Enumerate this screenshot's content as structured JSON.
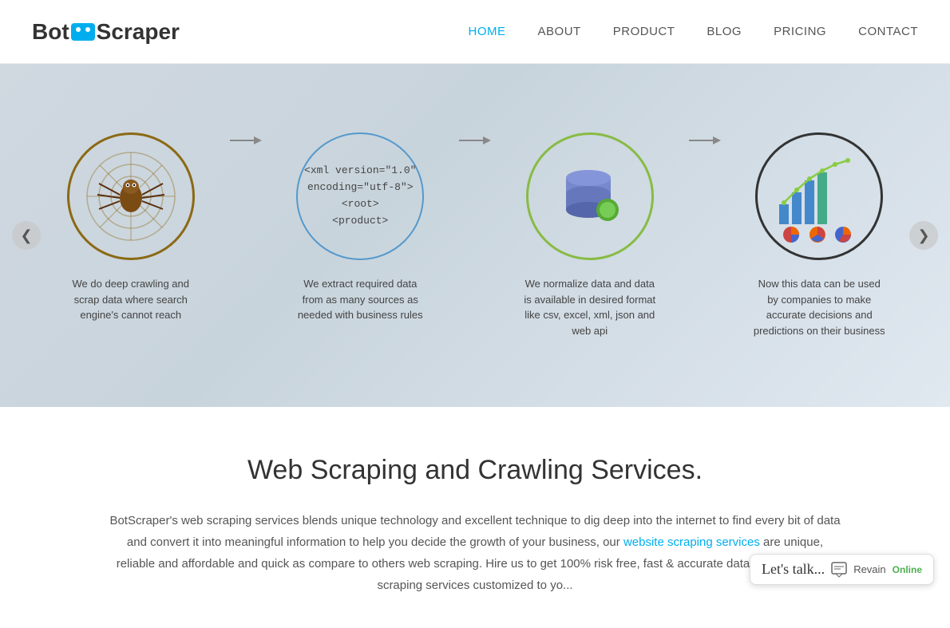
{
  "header": {
    "logo_text_bot": "Bot",
    "logo_text_scraper": "Scraper",
    "nav": [
      {
        "label": "HOME",
        "active": true,
        "id": "home"
      },
      {
        "label": "ABOUT",
        "active": false,
        "id": "about"
      },
      {
        "label": "PRODUCT",
        "active": false,
        "id": "product"
      },
      {
        "label": "BLOG",
        "active": false,
        "id": "blog"
      },
      {
        "label": "PRICING",
        "active": false,
        "id": "pricing"
      },
      {
        "label": "CONTACT",
        "active": false,
        "id": "contact"
      }
    ]
  },
  "hero": {
    "left_arrow": "❮",
    "right_arrow": "❯",
    "steps": [
      {
        "id": "spider",
        "desc": "We do deep crawling and scrap data where search engine's cannot reach"
      },
      {
        "id": "xml",
        "xml_line1": "<xml version=\"1.0\"",
        "xml_line2": "encoding=\"utf-8\">",
        "xml_line3": "<root>",
        "xml_line4": "<product>",
        "desc": "We extract required data from as many sources as needed with business rules"
      },
      {
        "id": "database",
        "desc": "We normalize data and data is available in desired format like csv, excel, xml, json and web api"
      },
      {
        "id": "chart",
        "desc": "Now this data can be used by companies to make accurate decisions and predictions on their business"
      }
    ]
  },
  "content": {
    "title": "Web Scraping and Crawling Services.",
    "desc_part1": "BotScraper's web scraping services blends unique technology and excellent technique to dig deep into the internet to find every bit of data and convert it into meaningful information to help you decide the growth of your business, our",
    "link_text": "website scraping services",
    "desc_part2": "are unique, reliable and affordable and quick as compare to others web scraping. Hire us to get 100% risk free, fast & accurate data extraction, web scraping services customized to yo..."
  },
  "chat_widget": {
    "lets_talk": "Let's talk...",
    "brand": "Revain",
    "status": "Online"
  }
}
